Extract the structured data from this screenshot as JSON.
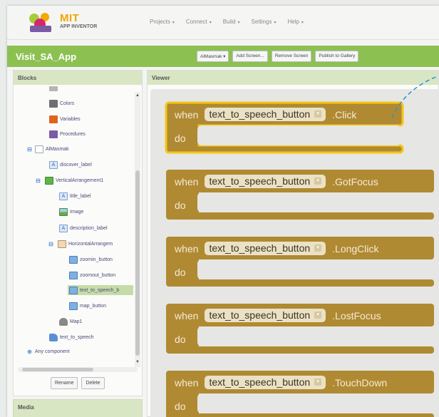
{
  "app": {
    "logo_text": "MIT",
    "logo_subtext": "APP INVENTOR",
    "menu": [
      {
        "label": "Projects"
      },
      {
        "label": "Connect"
      },
      {
        "label": "Build"
      },
      {
        "label": "Settings"
      },
      {
        "label": "Help"
      }
    ]
  },
  "project": {
    "title": "Visit_SA_App",
    "screen_select": "AlMasmak",
    "buttons": {
      "add_screen": "Add Screen...",
      "remove_screen": "Remove Screen",
      "publish": "Publish to Gallery"
    }
  },
  "blocks_panel": {
    "title": "Blocks",
    "tree": [
      {
        "label": "Colors",
        "icon": "gray"
      },
      {
        "label": "Variables",
        "icon": "orange"
      },
      {
        "label": "Procedures",
        "icon": "purple"
      },
      {
        "label": "AlMasmak",
        "icon": "screen"
      },
      {
        "label": "discover_label",
        "icon": "label"
      },
      {
        "label": "VerticalArrangement1",
        "icon": "green"
      },
      {
        "label": "title_label",
        "icon": "label"
      },
      {
        "label": "Image",
        "icon": "image"
      },
      {
        "label": "description_label",
        "icon": "label"
      },
      {
        "label": "HorizontalArrangem",
        "icon": "hor"
      },
      {
        "label": "zoomin_button",
        "icon": "button"
      },
      {
        "label": "zoomout_button",
        "icon": "button"
      },
      {
        "label": "text_to_speech_b",
        "icon": "button"
      },
      {
        "label": "map_button",
        "icon": "button"
      },
      {
        "label": "Map1",
        "icon": "map"
      },
      {
        "label": "text_to_speech",
        "icon": "tts"
      },
      {
        "label": "Any component",
        "icon": "none"
      }
    ],
    "rename_label": "Rename",
    "delete_label": "Delete"
  },
  "media_panel": {
    "title": "Media"
  },
  "viewer": {
    "title": "Viewer",
    "blocks": [
      {
        "when": "when",
        "component": "text_to_speech_button",
        "event": ".Click",
        "do": "do"
      },
      {
        "when": "when",
        "component": "text_to_speech_button",
        "event": ".GotFocus",
        "do": "do"
      },
      {
        "when": "when",
        "component": "text_to_speech_button",
        "event": ".LongClick",
        "do": "do"
      },
      {
        "when": "when",
        "component": "text_to_speech_button",
        "event": ".LostFocus",
        "do": "do"
      },
      {
        "when": "when",
        "component": "text_to_speech_button",
        "event": ".TouchDown",
        "do": "do"
      }
    ]
  },
  "colors": {
    "project_bar": "#8cc152",
    "panel_header": "#d8e6c3",
    "event_block": "#b08a32",
    "selected_outline": "#f5c518"
  }
}
